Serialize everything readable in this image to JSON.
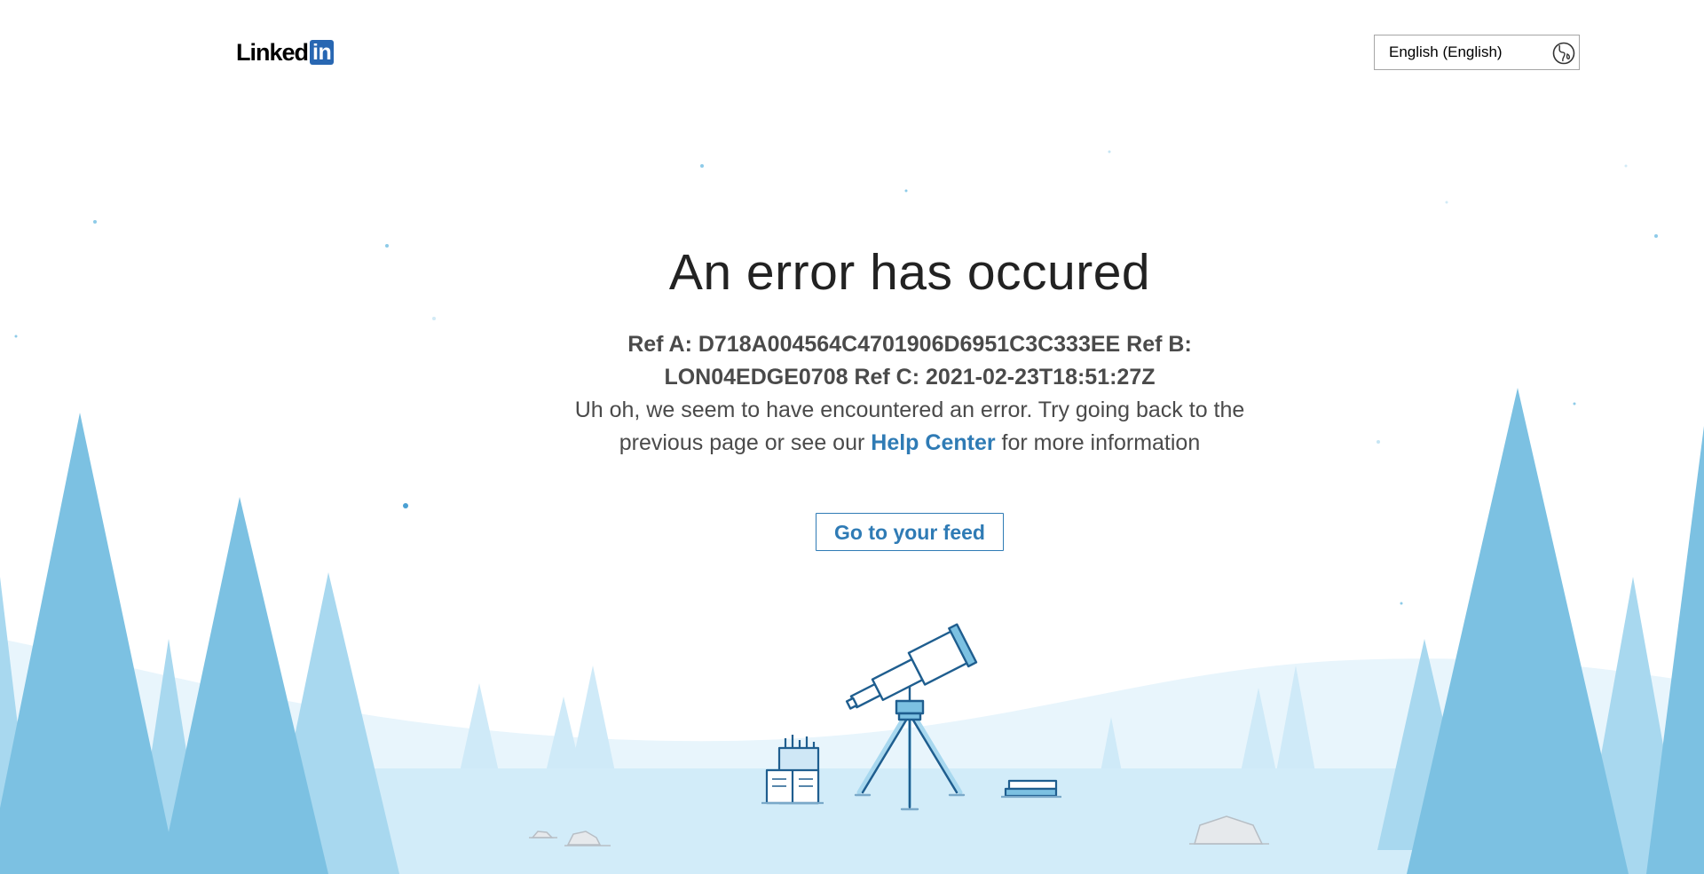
{
  "header": {
    "logo": {
      "word": "Linked",
      "box": "in"
    },
    "language_select": {
      "value": "English (English)",
      "icon": "globe-icon"
    }
  },
  "main": {
    "title": "An error has occured",
    "refs": "Ref A: D718A004564C4701906D6951C3C333EE Ref B: LON04EDGE0708 Ref C: 2021-02-23T18:51:27Z",
    "message_before": "Uh oh, we seem to have encountered an error. Try going back to the previous page or see our",
    "help_link": "Help Center",
    "message_after": "for more information",
    "feed_button": "Go to your feed"
  },
  "illustration": {
    "subject": "telescope-on-tripod",
    "items": [
      "book-stack",
      "pencil-cup",
      "tripod-telescope",
      "boulders",
      "pine-trees",
      "snowy-hills"
    ]
  },
  "colors": {
    "brand_blue": "#2867b2",
    "link_blue": "#2f7bb5",
    "tree_dark": "#7cc1e2",
    "tree_light": "#a8d8ef",
    "snow": "#d2ecf9",
    "hill": "#e8f5fc"
  }
}
